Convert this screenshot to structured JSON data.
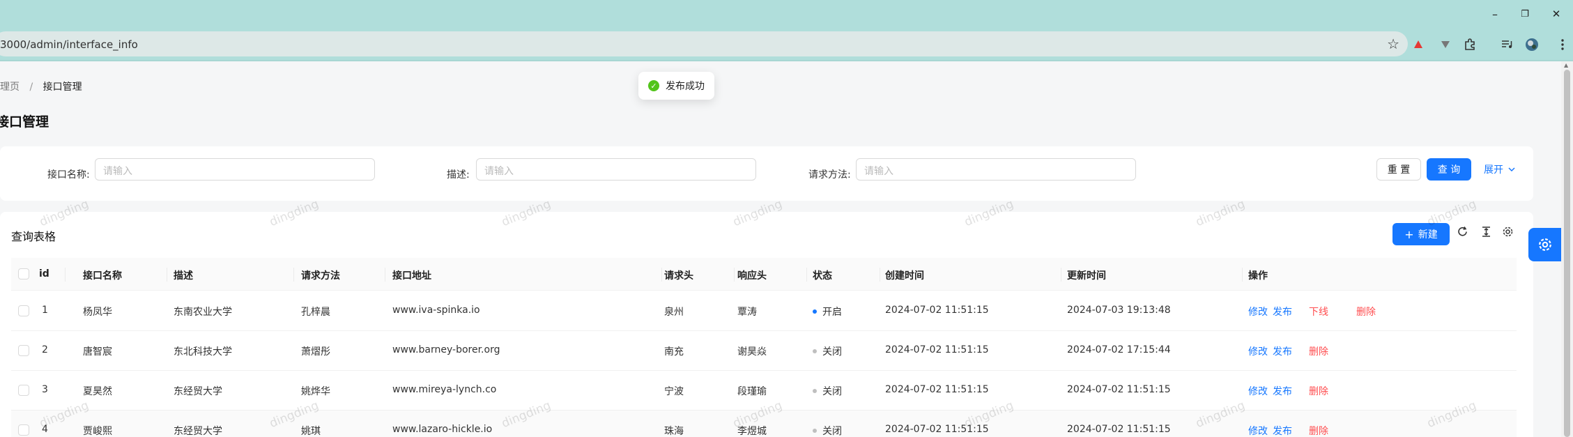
{
  "browser": {
    "url": "3000/admin/interface_info",
    "win_minimize": "–",
    "win_restore": "❐",
    "win_close": "✕",
    "star": "☆"
  },
  "breadcrumb": {
    "items": [
      "管理页",
      "接口管理"
    ],
    "separator": "/"
  },
  "page_title": "接口管理",
  "toast": {
    "icon": "✓",
    "text": "发布成功",
    "color": "#52c41a"
  },
  "search": {
    "fields": [
      {
        "label": "接口名称:",
        "placeholder": "请输入"
      },
      {
        "label": "描述:",
        "placeholder": "请输入"
      },
      {
        "label": "请求方法:",
        "placeholder": "请输入"
      }
    ],
    "reset": "重 置",
    "query": "查 询",
    "expand": "展开"
  },
  "table": {
    "title": "查询表格",
    "new_button": "新建",
    "columns": [
      "id",
      "接口名称",
      "描述",
      "请求方法",
      "接口地址",
      "请求头",
      "响应头",
      "状态",
      "创建时间",
      "更新时间",
      "操作"
    ],
    "rows": [
      {
        "id": "1",
        "name": "杨凤华",
        "desc": "东南农业大学",
        "method": "孔梓晨",
        "url": "www.iva-spinka.io",
        "req_header": "泉州",
        "res_header": "覃涛",
        "status": "开启",
        "status_color": "#1677ff",
        "created": "2024-07-02 11:51:15",
        "updated": "2024-07-03 19:13:48",
        "actions": [
          "修改",
          "发布",
          "下线",
          "删除"
        ]
      },
      {
        "id": "2",
        "name": "唐智宸",
        "desc": "东北科技大学",
        "method": "萧熠彤",
        "url": "www.barney-borer.org",
        "req_header": "南充",
        "res_header": "谢昊焱",
        "status": "关闭",
        "status_color": "#bfbfbf",
        "created": "2024-07-02 11:51:15",
        "updated": "2024-07-02 17:15:44",
        "actions": [
          "修改",
          "发布",
          "删除"
        ]
      },
      {
        "id": "3",
        "name": "夏昊然",
        "desc": "东经贸大学",
        "method": "姚烨华",
        "url": "www.mireya-lynch.co",
        "req_header": "宁波",
        "res_header": "段瑾瑜",
        "status": "关闭",
        "status_color": "#bfbfbf",
        "created": "2024-07-02 11:51:15",
        "updated": "2024-07-02 11:51:15",
        "actions": [
          "修改",
          "发布",
          "删除"
        ]
      },
      {
        "id": "4",
        "name": "贾峻熙",
        "desc": "东经贸大学",
        "method": "姚琪",
        "url": "www.lazaro-hickle.io",
        "req_header": "珠海",
        "res_header": "李煜城",
        "status": "关闭",
        "status_color": "#bfbfbf",
        "created": "2024-07-02 11:51:15",
        "updated": "2024-07-02 11:51:15",
        "actions": [
          "修改",
          "发布",
          "删除"
        ]
      }
    ]
  },
  "watermark": "dingding",
  "colors": {
    "primary": "#1677ff",
    "danger": "#ff4d4f",
    "success": "#52c41a",
    "browser_frame": "#b0dedb"
  }
}
